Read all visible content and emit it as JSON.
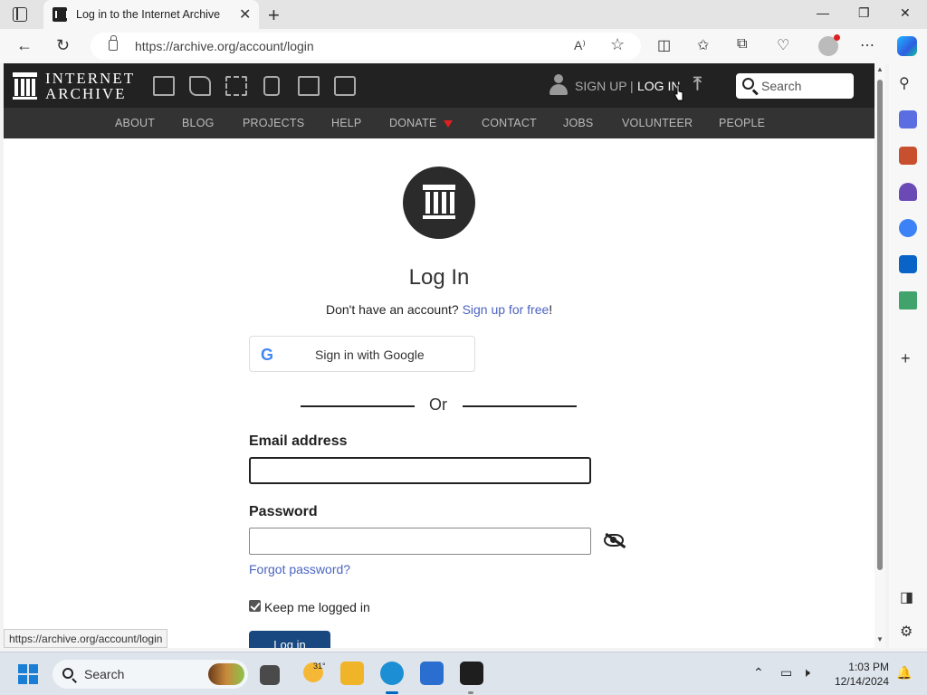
{
  "browser": {
    "tab_title": "Log in to the Internet Archive",
    "tab_close": "✕",
    "new_tab": "+",
    "url": "https://archive.org/account/login",
    "read_aloud": "A⁾",
    "win_minimize": "—",
    "win_restore": "❐",
    "win_close": "✕"
  },
  "ia_header": {
    "logo_line1": "INTERNET",
    "logo_line2": "ARCHIVE",
    "sign_up": "SIGN UP",
    "separator": "|",
    "log_in": "LOG IN",
    "search_placeholder": "Search"
  },
  "ia_nav": [
    {
      "label": "ABOUT"
    },
    {
      "label": "BLOG"
    },
    {
      "label": "PROJECTS"
    },
    {
      "label": "HELP"
    },
    {
      "label": "DONATE"
    },
    {
      "label": "CONTACT"
    },
    {
      "label": "JOBS"
    },
    {
      "label": "VOLUNTEER"
    },
    {
      "label": "PEOPLE"
    }
  ],
  "login": {
    "title": "Log In",
    "no_account_text": "Don't have an account?",
    "signup_link": "Sign up for free",
    "signup_suffix": "!",
    "google_label": "Sign in with Google",
    "or_text": "Or",
    "email_label": "Email address",
    "email_value": "",
    "password_label": "Password",
    "password_value": "",
    "forgot_password": "Forgot password?",
    "keep_logged_in": "Keep me logged in",
    "keep_logged_in_checked": true,
    "login_button": "Log in"
  },
  "status_url": "https://archive.org/account/login",
  "taskbar": {
    "search_label": "Search",
    "weather_temp": "31°",
    "time": "1:03 PM",
    "date": "12/14/2024"
  },
  "colors": {
    "ia_header_bg": "#222222",
    "ia_nav_bg": "#333333",
    "link_blue": "#4b64c0",
    "login_button_bg": "#194880",
    "donate_caret": "#e02020"
  }
}
